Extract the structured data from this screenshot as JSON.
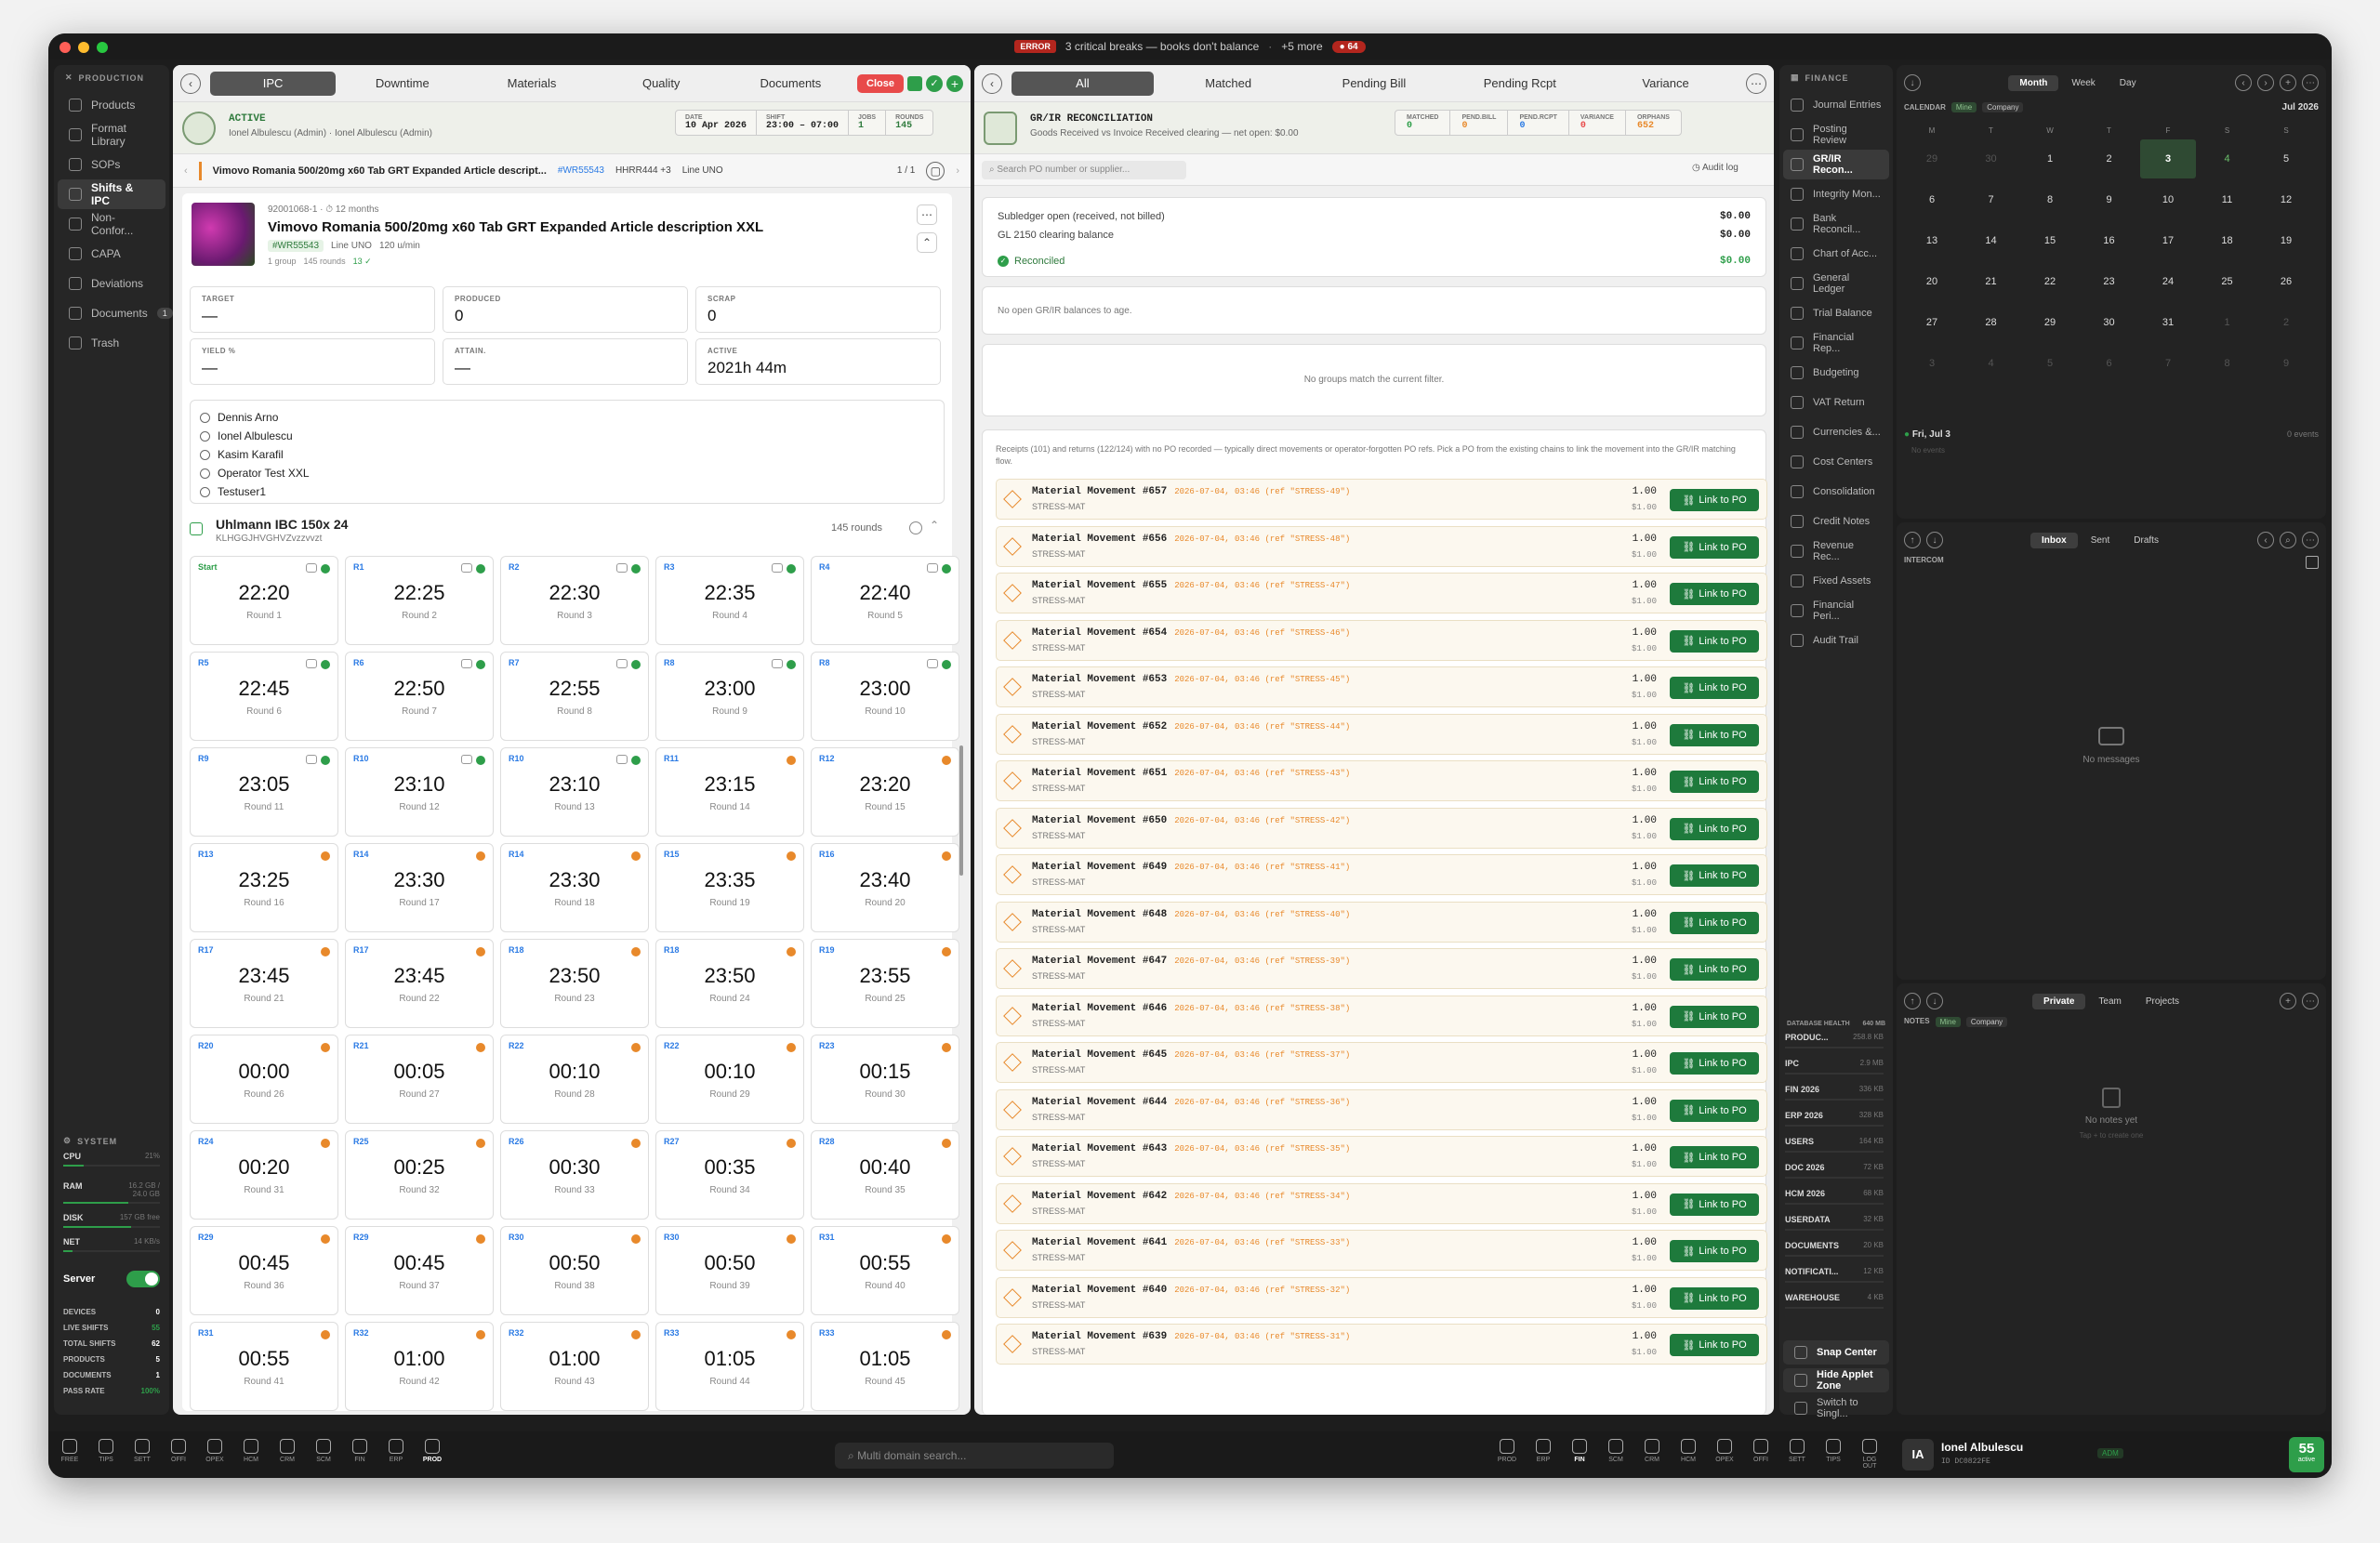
{
  "titlebar": {
    "error_tag": "ERROR",
    "message": "3 critical breaks — books don't balance",
    "more": "+5 more",
    "badge": "64"
  },
  "left_nav": {
    "section": "PRODUCTION",
    "items": [
      {
        "label": "Products",
        "icon": "box-icon"
      },
      {
        "label": "Format Library",
        "icon": "library-icon"
      },
      {
        "label": "SOPs",
        "icon": "document-icon"
      },
      {
        "label": "Shifts & IPC",
        "icon": "clipboard-icon",
        "active": true
      },
      {
        "label": "Non-Confor...",
        "icon": "warning-icon"
      },
      {
        "label": "CAPA",
        "icon": "capa-icon"
      },
      {
        "label": "Deviations",
        "icon": "deviation-icon"
      },
      {
        "label": "Documents",
        "icon": "folder-icon",
        "count": "1"
      },
      {
        "label": "Trash",
        "icon": "trash-icon"
      }
    ],
    "system": {
      "title": "SYSTEM",
      "cpu_label": "CPU",
      "cpu_val": "21%",
      "ram_label": "RAM",
      "ram_val": "16.2 GB / 24.0 GB",
      "disk_label": "DISK",
      "disk_val": "157 GB free",
      "net_label": "NET",
      "net_val": "14 KB/s",
      "server_label": "Server"
    },
    "stats": [
      {
        "label": "DEVICES",
        "value": "0"
      },
      {
        "label": "LIVE SHIFTS",
        "value": "55"
      },
      {
        "label": "TOTAL SHIFTS",
        "value": "62"
      },
      {
        "label": "PRODUCTS",
        "value": "5"
      },
      {
        "label": "DOCUMENTS",
        "value": "1"
      },
      {
        "label": "PASS RATE",
        "value": "100%"
      }
    ]
  },
  "ipc": {
    "tabs": [
      "IPC",
      "Downtime",
      "Materials",
      "Quality",
      "Documents"
    ],
    "close_label": "Close",
    "status": "ACTIVE",
    "status_sub": "Ionel Albulescu (Admin) · Ionel Albulescu (Admin)",
    "date_label": "DATE",
    "date": "10 Apr 2026",
    "shift_label": "SHIFT",
    "shift": "23:00 – 07:00",
    "jobs_label": "JOBS",
    "jobs": "1",
    "rounds_label": "ROUNDS",
    "rounds": "145",
    "product_bar": {
      "name": "Vimovo Romania 500/20mg x60 Tab GRT Expanded Article  descript...",
      "wr": "#WR55543",
      "hhr": "HHRR444 +3",
      "line": "Line UNO",
      "pager": "1 / 1"
    },
    "product": {
      "code": "92001068-1",
      "age": "12 months",
      "title": "Vimovo Romania 500/20mg x60 Tab GRT Expanded Article  description XXL",
      "wr": "#WR55543",
      "line": "Line UNO",
      "rate": "120 u/min",
      "group": "1 group",
      "rounds": "145 rounds",
      "ok": "13 ✓"
    },
    "kpis": [
      {
        "label": "TARGET",
        "value": "—"
      },
      {
        "label": "PRODUCED",
        "value": "0"
      },
      {
        "label": "SCRAP",
        "value": "0"
      },
      {
        "label": "YIELD %",
        "value": "—"
      },
      {
        "label": "ATTAIN.",
        "value": "—"
      },
      {
        "label": "ACTIVE",
        "value": "2021h 44m"
      }
    ],
    "operators": [
      "Dennis Arno",
      "Ionel Albulescu",
      "Kasim Karafil",
      "Operator Test XXL",
      "Testuser1"
    ],
    "machine": {
      "name": "Uhlmann IBC 150x 24",
      "code": "KLHGGJHVGHVZvzzvvzt",
      "rounds": "145 rounds"
    },
    "rounds_grid": [
      {
        "tag": "Start",
        "time": "22:20",
        "name": "Round 1",
        "ok": true
      },
      {
        "tag": "R1",
        "time": "22:25",
        "name": "Round 2",
        "ok": true
      },
      {
        "tag": "R2",
        "time": "22:30",
        "name": "Round 3",
        "ok": true
      },
      {
        "tag": "R3",
        "time": "22:35",
        "name": "Round 4",
        "ok": true
      },
      {
        "tag": "R4",
        "time": "22:40",
        "name": "Round 5",
        "ok": true
      },
      {
        "tag": "R5",
        "time": "22:45",
        "name": "Round 6",
        "ok": true
      },
      {
        "tag": "R6",
        "time": "22:50",
        "name": "Round 7",
        "ok": true
      },
      {
        "tag": "R7",
        "time": "22:55",
        "name": "Round 8",
        "ok": true
      },
      {
        "tag": "R8",
        "time": "23:00",
        "name": "Round 9",
        "ok": true
      },
      {
        "tag": "R8",
        "time": "23:00",
        "name": "Round 10",
        "ok": true
      },
      {
        "tag": "R9",
        "time": "23:05",
        "name": "Round 11",
        "ok": true
      },
      {
        "tag": "R10",
        "time": "23:10",
        "name": "Round 12",
        "ok": true
      },
      {
        "tag": "R10",
        "time": "23:10",
        "name": "Round 13",
        "ok": true
      },
      {
        "tag": "R11",
        "time": "23:15",
        "name": "Round 14",
        "ok": false
      },
      {
        "tag": "R12",
        "time": "23:20",
        "name": "Round 15",
        "ok": false
      },
      {
        "tag": "R13",
        "time": "23:25",
        "name": "Round 16",
        "ok": false
      },
      {
        "tag": "R14",
        "time": "23:30",
        "name": "Round 17",
        "ok": false
      },
      {
        "tag": "R14",
        "time": "23:30",
        "name": "Round 18",
        "ok": false
      },
      {
        "tag": "R15",
        "time": "23:35",
        "name": "Round 19",
        "ok": false
      },
      {
        "tag": "R16",
        "time": "23:40",
        "name": "Round 20",
        "ok": false
      },
      {
        "tag": "R17",
        "time": "23:45",
        "name": "Round 21",
        "ok": false
      },
      {
        "tag": "R17",
        "time": "23:45",
        "name": "Round 22",
        "ok": false
      },
      {
        "tag": "R18",
        "time": "23:50",
        "name": "Round 23",
        "ok": false
      },
      {
        "tag": "R18",
        "time": "23:50",
        "name": "Round 24",
        "ok": false
      },
      {
        "tag": "R19",
        "time": "23:55",
        "name": "Round 25",
        "ok": false
      },
      {
        "tag": "R20",
        "time": "00:00",
        "name": "Round 26",
        "ok": false
      },
      {
        "tag": "R21",
        "time": "00:05",
        "name": "Round 27",
        "ok": false
      },
      {
        "tag": "R22",
        "time": "00:10",
        "name": "Round 28",
        "ok": false
      },
      {
        "tag": "R22",
        "time": "00:10",
        "name": "Round 29",
        "ok": false
      },
      {
        "tag": "R23",
        "time": "00:15",
        "name": "Round 30",
        "ok": false
      },
      {
        "tag": "R24",
        "time": "00:20",
        "name": "Round 31",
        "ok": false
      },
      {
        "tag": "R25",
        "time": "00:25",
        "name": "Round 32",
        "ok": false
      },
      {
        "tag": "R26",
        "time": "00:30",
        "name": "Round 33",
        "ok": false
      },
      {
        "tag": "R27",
        "time": "00:35",
        "name": "Round 34",
        "ok": false
      },
      {
        "tag": "R28",
        "time": "00:40",
        "name": "Round 35",
        "ok": false
      },
      {
        "tag": "R29",
        "time": "00:45",
        "name": "Round 36",
        "ok": false
      },
      {
        "tag": "R29",
        "time": "00:45",
        "name": "Round 37",
        "ok": false
      },
      {
        "tag": "R30",
        "time": "00:50",
        "name": "Round 38",
        "ok": false
      },
      {
        "tag": "R30",
        "time": "00:50",
        "name": "Round 39",
        "ok": false
      },
      {
        "tag": "R31",
        "time": "00:55",
        "name": "Round 40",
        "ok": false
      },
      {
        "tag": "R31",
        "time": "00:55",
        "name": "Round 41",
        "ok": false
      },
      {
        "tag": "R32",
        "time": "01:00",
        "name": "Round 42",
        "ok": false
      },
      {
        "tag": "R32",
        "time": "01:00",
        "name": "Round 43",
        "ok": false
      },
      {
        "tag": "R33",
        "time": "01:05",
        "name": "Round 44",
        "ok": false
      },
      {
        "tag": "R33",
        "time": "01:05",
        "name": "Round 45",
        "ok": false
      }
    ]
  },
  "grir": {
    "tabs": [
      "All",
      "Matched",
      "Pending Bill",
      "Pending Rcpt",
      "Variance"
    ],
    "title": "GR/IR RECONCILIATION",
    "subtitle": "Goods Received vs Invoice Received clearing — net open: $0.00",
    "stats": [
      {
        "label": "MATCHED",
        "value": "0"
      },
      {
        "label": "PEND.BILL",
        "value": "0"
      },
      {
        "label": "PEND.RCPT",
        "value": "0"
      },
      {
        "label": "VARIANCE",
        "value": "0"
      },
      {
        "label": "ORPHANS",
        "value": "652"
      }
    ],
    "search_placeholder": "Search PO number or supplier...",
    "audit_label": "Audit log",
    "summary": [
      {
        "label": "Subledger open (received, not billed)",
        "value": "$0.00"
      },
      {
        "label": "GL 2150 clearing balance",
        "value": "$0.00"
      }
    ],
    "reconciled_label": "Reconciled",
    "reconciled_value": "$0.00",
    "no_open": "No open GR/IR balances to age.",
    "no_groups": "No groups match the current filter.",
    "orphan_note": "Receipts (101) and returns (122/124) with no PO recorded — typically direct movements or operator-forgotten PO refs. Pick a PO from the existing chains to link the movement into the GR/IR matching flow.",
    "link_label": "Link to PO",
    "movements": [
      {
        "title": "Material Movement #657",
        "meta": "2026-07-04, 03:46 (ref \"STRESS-49\")",
        "sub": "STRESS-MAT",
        "qty": "1.00",
        "price": "$1.00"
      },
      {
        "title": "Material Movement #656",
        "meta": "2026-07-04, 03:46 (ref \"STRESS-48\")",
        "sub": "STRESS-MAT",
        "qty": "1.00",
        "price": "$1.00"
      },
      {
        "title": "Material Movement #655",
        "meta": "2026-07-04, 03:46 (ref \"STRESS-47\")",
        "sub": "STRESS-MAT",
        "qty": "1.00",
        "price": "$1.00"
      },
      {
        "title": "Material Movement #654",
        "meta": "2026-07-04, 03:46 (ref \"STRESS-46\")",
        "sub": "STRESS-MAT",
        "qty": "1.00",
        "price": "$1.00"
      },
      {
        "title": "Material Movement #653",
        "meta": "2026-07-04, 03:46 (ref \"STRESS-45\")",
        "sub": "STRESS-MAT",
        "qty": "1.00",
        "price": "$1.00"
      },
      {
        "title": "Material Movement #652",
        "meta": "2026-07-04, 03:46 (ref \"STRESS-44\")",
        "sub": "STRESS-MAT",
        "qty": "1.00",
        "price": "$1.00"
      },
      {
        "title": "Material Movement #651",
        "meta": "2026-07-04, 03:46 (ref \"STRESS-43\")",
        "sub": "STRESS-MAT",
        "qty": "1.00",
        "price": "$1.00"
      },
      {
        "title": "Material Movement #650",
        "meta": "2026-07-04, 03:46 (ref \"STRESS-42\")",
        "sub": "STRESS-MAT",
        "qty": "1.00",
        "price": "$1.00"
      },
      {
        "title": "Material Movement #649",
        "meta": "2026-07-04, 03:46 (ref \"STRESS-41\")",
        "sub": "STRESS-MAT",
        "qty": "1.00",
        "price": "$1.00"
      },
      {
        "title": "Material Movement #648",
        "meta": "2026-07-04, 03:46 (ref \"STRESS-40\")",
        "sub": "STRESS-MAT",
        "qty": "1.00",
        "price": "$1.00"
      },
      {
        "title": "Material Movement #647",
        "meta": "2026-07-04, 03:46 (ref \"STRESS-39\")",
        "sub": "STRESS-MAT",
        "qty": "1.00",
        "price": "$1.00"
      },
      {
        "title": "Material Movement #646",
        "meta": "2026-07-04, 03:46 (ref \"STRESS-38\")",
        "sub": "STRESS-MAT",
        "qty": "1.00",
        "price": "$1.00"
      },
      {
        "title": "Material Movement #645",
        "meta": "2026-07-04, 03:46 (ref \"STRESS-37\")",
        "sub": "STRESS-MAT",
        "qty": "1.00",
        "price": "$1.00"
      },
      {
        "title": "Material Movement #644",
        "meta": "2026-07-04, 03:46 (ref \"STRESS-36\")",
        "sub": "STRESS-MAT",
        "qty": "1.00",
        "price": "$1.00"
      },
      {
        "title": "Material Movement #643",
        "meta": "2026-07-04, 03:46 (ref \"STRESS-35\")",
        "sub": "STRESS-MAT",
        "qty": "1.00",
        "price": "$1.00"
      },
      {
        "title": "Material Movement #642",
        "meta": "2026-07-04, 03:46 (ref \"STRESS-34\")",
        "sub": "STRESS-MAT",
        "qty": "1.00",
        "price": "$1.00"
      },
      {
        "title": "Material Movement #641",
        "meta": "2026-07-04, 03:46 (ref \"STRESS-33\")",
        "sub": "STRESS-MAT",
        "qty": "1.00",
        "price": "$1.00"
      },
      {
        "title": "Material Movement #640",
        "meta": "2026-07-04, 03:46 (ref \"STRESS-32\")",
        "sub": "STRESS-MAT",
        "qty": "1.00",
        "price": "$1.00"
      },
      {
        "title": "Material Movement #639",
        "meta": "2026-07-04, 03:46 (ref \"STRESS-31\")",
        "sub": "STRESS-MAT",
        "qty": "1.00",
        "price": "$1.00"
      }
    ]
  },
  "finance_nav": {
    "section": "FINANCE",
    "items": [
      {
        "label": "Journal Entries"
      },
      {
        "label": "Posting Review"
      },
      {
        "label": "GR/IR Recon...",
        "active": true
      },
      {
        "label": "Integrity Mon..."
      },
      {
        "label": "Bank Reconcil..."
      },
      {
        "label": "Chart of Acc..."
      },
      {
        "label": "General Ledger"
      },
      {
        "label": "Trial Balance"
      },
      {
        "label": "Financial Rep..."
      },
      {
        "label": "Budgeting"
      },
      {
        "label": "VAT Return"
      },
      {
        "label": "Currencies &..."
      },
      {
        "label": "Cost Centers"
      },
      {
        "label": "Consolidation"
      },
      {
        "label": "Credit Notes"
      },
      {
        "label": "Revenue Rec..."
      },
      {
        "label": "Fixed Assets"
      },
      {
        "label": "Financial Peri..."
      },
      {
        "label": "Audit Trail"
      }
    ],
    "db_title": "DATABASE HEALTH",
    "db_total": "640 MB",
    "dbs": [
      {
        "name": "PRODUC...",
        "size": "258.8 KB"
      },
      {
        "name": "IPC",
        "size": "2.9 MB"
      },
      {
        "name": "FIN 2026",
        "size": "336 KB"
      },
      {
        "name": "ERP 2026",
        "size": "328 KB"
      },
      {
        "name": "USERS",
        "size": "164 KB"
      },
      {
        "name": "DOC 2026",
        "size": "72 KB"
      },
      {
        "name": "HCM 2026",
        "size": "68 KB"
      },
      {
        "name": "USERDATA",
        "size": "32 KB"
      },
      {
        "name": "DOCUMENTS",
        "size": "20 KB"
      },
      {
        "name": "NOTIFICATI...",
        "size": "12 KB"
      },
      {
        "name": "WAREHOUSE",
        "size": "4 KB"
      }
    ],
    "snap_center": "Snap Center",
    "hide_applet": "Hide Applet Zone",
    "switch_single": "Switch to Singl..."
  },
  "calendar": {
    "views": [
      "Month",
      "Week",
      "Day"
    ],
    "label": "CALENDAR",
    "mine": "Mine",
    "company": "Company",
    "month": "Jul 2026",
    "weekdays": [
      "M",
      "T",
      "W",
      "T",
      "F",
      "S",
      "S"
    ],
    "days": [
      "29",
      "30",
      "1",
      "2",
      "3",
      "4",
      "5",
      "6",
      "7",
      "8",
      "9",
      "10",
      "11",
      "12",
      "13",
      "14",
      "15",
      "16",
      "17",
      "18",
      "19",
      "20",
      "21",
      "22",
      "23",
      "24",
      "25",
      "26",
      "27",
      "28",
      "29",
      "30",
      "31",
      "1",
      "2",
      "3",
      "4",
      "5",
      "6",
      "7",
      "8",
      "9"
    ],
    "selected": "Fri, Jul 3",
    "events": "0 events",
    "no_events": "No events"
  },
  "mail": {
    "tabs": [
      "Inbox",
      "Sent",
      "Drafts"
    ],
    "label": "INTERCOM",
    "empty": "No messages"
  },
  "notes": {
    "tabs": [
      "Private",
      "Team",
      "Projects"
    ],
    "label": "NOTES",
    "mine": "Mine",
    "company": "Company",
    "empty": "No notes yet",
    "hint": "Tap + to create one"
  },
  "dock": {
    "left": [
      {
        "label": "FREE",
        "icon": "star-icon"
      },
      {
        "label": "TIPS",
        "icon": "help-icon"
      },
      {
        "label": "SETT",
        "icon": "gear-icon"
      },
      {
        "label": "OFFI",
        "icon": "office-icon"
      },
      {
        "label": "OPEX",
        "icon": "clock-icon"
      },
      {
        "label": "HCM",
        "icon": "id-card-icon"
      },
      {
        "label": "CRM",
        "icon": "crm-icon"
      },
      {
        "label": "SCM",
        "icon": "cube-icon"
      },
      {
        "label": "FIN",
        "icon": "bank-icon"
      },
      {
        "label": "ERP",
        "icon": "chart-icon"
      },
      {
        "label": "PROD",
        "icon": "tools-icon",
        "active": true
      }
    ],
    "search_placeholder": "Multi domain search...",
    "right": [
      {
        "label": "PROD",
        "icon": "tools-icon"
      },
      {
        "label": "ERP",
        "icon": "chart-icon"
      },
      {
        "label": "FIN",
        "icon": "bank-icon",
        "active": true
      },
      {
        "label": "SCM",
        "icon": "cube-icon"
      },
      {
        "label": "CRM",
        "icon": "crm-icon"
      },
      {
        "label": "HCM",
        "icon": "id-card-icon"
      },
      {
        "label": "OPEX",
        "icon": "clock-icon"
      },
      {
        "label": "OFFI",
        "icon": "office-icon"
      },
      {
        "label": "SETT",
        "icon": "gear-icon"
      },
      {
        "label": "TIPS",
        "icon": "help-icon"
      },
      {
        "label": "LOG OUT",
        "icon": "lock-icon"
      }
    ],
    "user_initials": "IA",
    "user_name": "Ionel Albulescu",
    "user_id": "ID DC0822FE",
    "user_role": "ADM",
    "active_count": "55",
    "active_label": "active"
  },
  "colors": {
    "accent_green": "#1e7a3c",
    "error_red": "#b3261e",
    "pending_orange": "#e8892b",
    "ok_green": "#2e9e4a",
    "tag_blue": "#2a7ae4"
  }
}
